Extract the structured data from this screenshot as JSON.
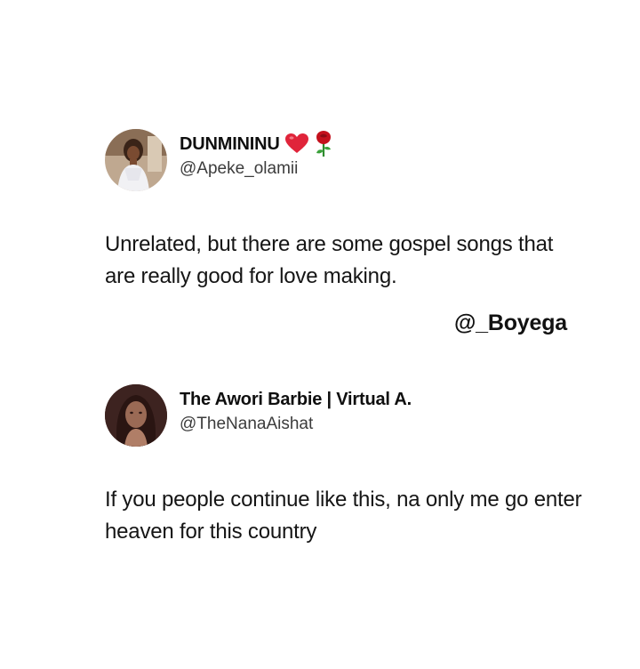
{
  "tweets": [
    {
      "display_name": "DUNMININU",
      "emoji_icons": [
        "red-heart-icon",
        "rose-icon"
      ],
      "handle": "@Apeke_olamii",
      "text": "Unrelated, but there are some gospel songs that are really good for love making."
    },
    {
      "display_name": "The Awori Barbie | Virtual A.",
      "emoji_icons": [],
      "handle": "@TheNanaAishat",
      "text": "If you people continue like this, na only me go enter heaven for this country"
    }
  ],
  "credit": "@_Boyega",
  "colors": {
    "background": "#ffffff",
    "text": "#151515",
    "handle": "#3c3c3c",
    "heart": "#e0243a",
    "rose": "#c4101c"
  }
}
